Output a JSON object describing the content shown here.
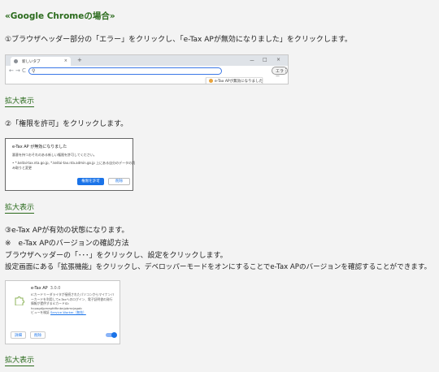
{
  "heading": "«Google Chromeの場合»",
  "step1": "①ブラウザヘッダー部分の「エラー」をクリックし、「e-Tax APが無効になりました」をクリックします。",
  "browser": {
    "tab_title": "新しいタブ",
    "tab_close": "×",
    "new_tab": "+",
    "window_controls": [
      "ー",
      "□",
      "×"
    ],
    "nav": [
      "←",
      "→",
      "C"
    ],
    "error_button": "エラー",
    "menu": "⋮",
    "popup": "e-Tax APが無効になりました"
  },
  "enlarge": "拡大表示",
  "step2": "②「権限を許可」をクリックします。",
  "dialog": {
    "title": "e-Tax AP が無効になりました",
    "line1": "悪意を持つおそれのある新しい権限を許可してください。",
    "line2": "• *.keitai-tax.nta.go.jp, *.keitai-tax.nta.admin.go.jp 上にある自分のデータの読",
    "line3": "み取りと変更",
    "allow": "権限を許可",
    "deny": "削除"
  },
  "step3": "③e-Tax APが有効の状態になります。",
  "note": "※　e-Tax APのバージョンの確認方法",
  "note_line1": "ブラウザヘッダーの「･･･」をクリックし、設定をクリックします。",
  "note_line2": "設定画面にある「拡張機能」をクリックし、デベロッパーモードをオンにすることでe-Tax APのバージョンを確認することができます。",
  "extension": {
    "name": "e-Tax AP",
    "version": "3.0.0",
    "desc": "ICカードリーダライタが接続されたパソコンからマイナンバーカードを利用してe-Taxへのログイン、電子証明書の発行情報が提供するICカードID: hcpagdjpmegfdfknbnjpbmcjagab",
    "view_label": "ビューを検証",
    "view_link": "Service Worker（無効）",
    "details": "詳細",
    "remove": "削除"
  }
}
